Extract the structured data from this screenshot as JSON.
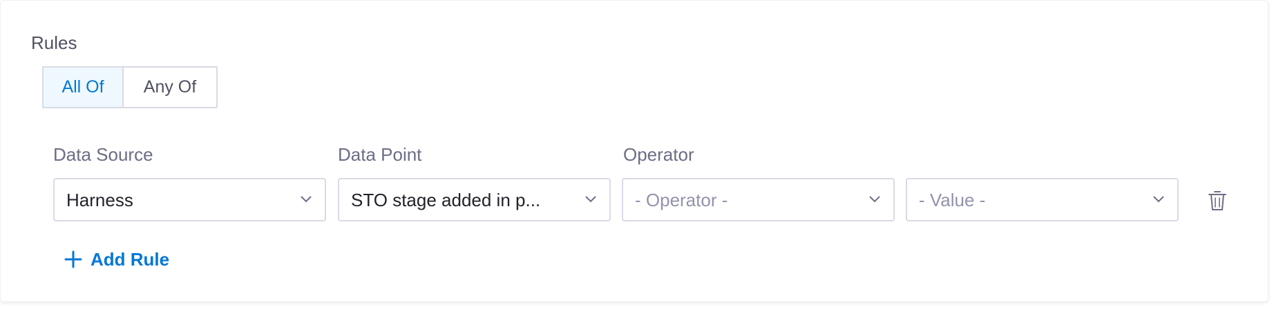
{
  "rules": {
    "title": "Rules",
    "toggle": {
      "all_of": "All Of",
      "any_of": "Any Of",
      "selected": "All Of"
    },
    "labels": {
      "data_source": "Data Source",
      "data_point": "Data Point",
      "operator": "Operator"
    },
    "row": {
      "data_source_value": "Harness",
      "data_point_value": "STO stage added in p...",
      "operator_placeholder": "- Operator -",
      "value_placeholder": "- Value -"
    },
    "add_rule_label": "Add Rule"
  },
  "icons": {
    "chevron": "chevron-down-icon",
    "delete": "trash-icon",
    "add": "plus-icon"
  },
  "colors": {
    "accent": "#0278d5",
    "selected_bg": "#eef8fe",
    "border": "#d9dae5",
    "text": "#22222a",
    "muted": "#6b6d85",
    "placeholder": "#9293ab"
  }
}
